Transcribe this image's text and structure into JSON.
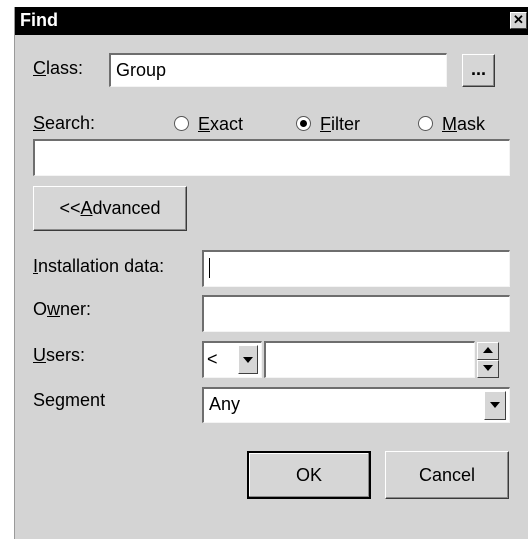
{
  "window": {
    "title": "Find",
    "close_glyph": "✕"
  },
  "class": {
    "label_prefix": "",
    "label_accel": "C",
    "label_rest": "lass:",
    "value": "Group",
    "browse_label": "..."
  },
  "search": {
    "label_accel": "S",
    "label_rest": "earch:",
    "value": "",
    "modes": [
      {
        "accel": "E",
        "rest": "xact",
        "checked": false
      },
      {
        "accel": "F",
        "rest": "ilter",
        "checked": true
      },
      {
        "accel": "M",
        "rest": "ask",
        "checked": false
      }
    ]
  },
  "advanced_button": {
    "prefix": "<<",
    "accel": "A",
    "rest": "dvanced"
  },
  "installation": {
    "label_accel": "I",
    "label_rest": "nstallation data:",
    "value": ""
  },
  "owner": {
    "label_prefix": "O",
    "label_accel": "w",
    "label_rest": "ner:",
    "value": ""
  },
  "users": {
    "label_accel": "U",
    "label_rest": "sers:",
    "operator": "<",
    "value": ""
  },
  "segment": {
    "label_prefix": "Se",
    "label_accel": "g",
    "label_rest": "ment",
    "value": "Any"
  },
  "buttons": {
    "ok": "OK",
    "cancel": "Cancel"
  },
  "icons": {
    "close": "close-icon",
    "dropdown": "chevron-down-icon",
    "spin_up": "chevron-up-icon",
    "spin_down": "chevron-down-icon"
  }
}
